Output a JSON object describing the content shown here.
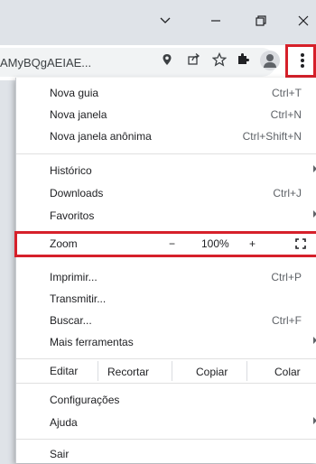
{
  "window": {
    "dropdown_icon": "chevron-down-icon",
    "minimize_icon": "minimize-icon",
    "restore_icon": "restore-icon",
    "close_icon": "close-icon"
  },
  "toolbar": {
    "url": "AMyBQgAEIAE...",
    "icons": [
      "location-pin-icon",
      "share-icon",
      "star-icon",
      "extensions-icon",
      "profile-icon",
      "menu-kebab-icon"
    ]
  },
  "menu": {
    "items_top": [
      {
        "label": "Nova guia",
        "shortcut": "Ctrl+T"
      },
      {
        "label": "Nova janela",
        "shortcut": "Ctrl+N"
      },
      {
        "label": "Nova janela anônima",
        "shortcut": "Ctrl+Shift+N"
      }
    ],
    "items_mid": [
      {
        "label": "Histórico",
        "shortcut": ""
      },
      {
        "label": "Downloads",
        "shortcut": "Ctrl+J"
      },
      {
        "label": "Favoritos",
        "shortcut": ""
      }
    ],
    "zoom": {
      "label": "Zoom",
      "minus": "−",
      "value": "100%",
      "plus": "+"
    },
    "items_tools": [
      {
        "label": "Imprimir...",
        "shortcut": "Ctrl+P"
      },
      {
        "label": "Transmitir...",
        "shortcut": ""
      },
      {
        "label": "Buscar...",
        "shortcut": "Ctrl+F"
      },
      {
        "label": "Mais ferramentas",
        "shortcut": ""
      }
    ],
    "edit": {
      "label": "Editar",
      "cut": "Recortar",
      "copy": "Copiar",
      "paste": "Colar"
    },
    "items_help": [
      {
        "label": "Configurações",
        "shortcut": ""
      },
      {
        "label": "Ajuda",
        "shortcut": ""
      }
    ],
    "exit": {
      "label": "Sair"
    }
  },
  "colors": {
    "highlight": "#d6202a",
    "menu_bg": "#ffffff",
    "frame_bg": "#dfe3e8"
  }
}
